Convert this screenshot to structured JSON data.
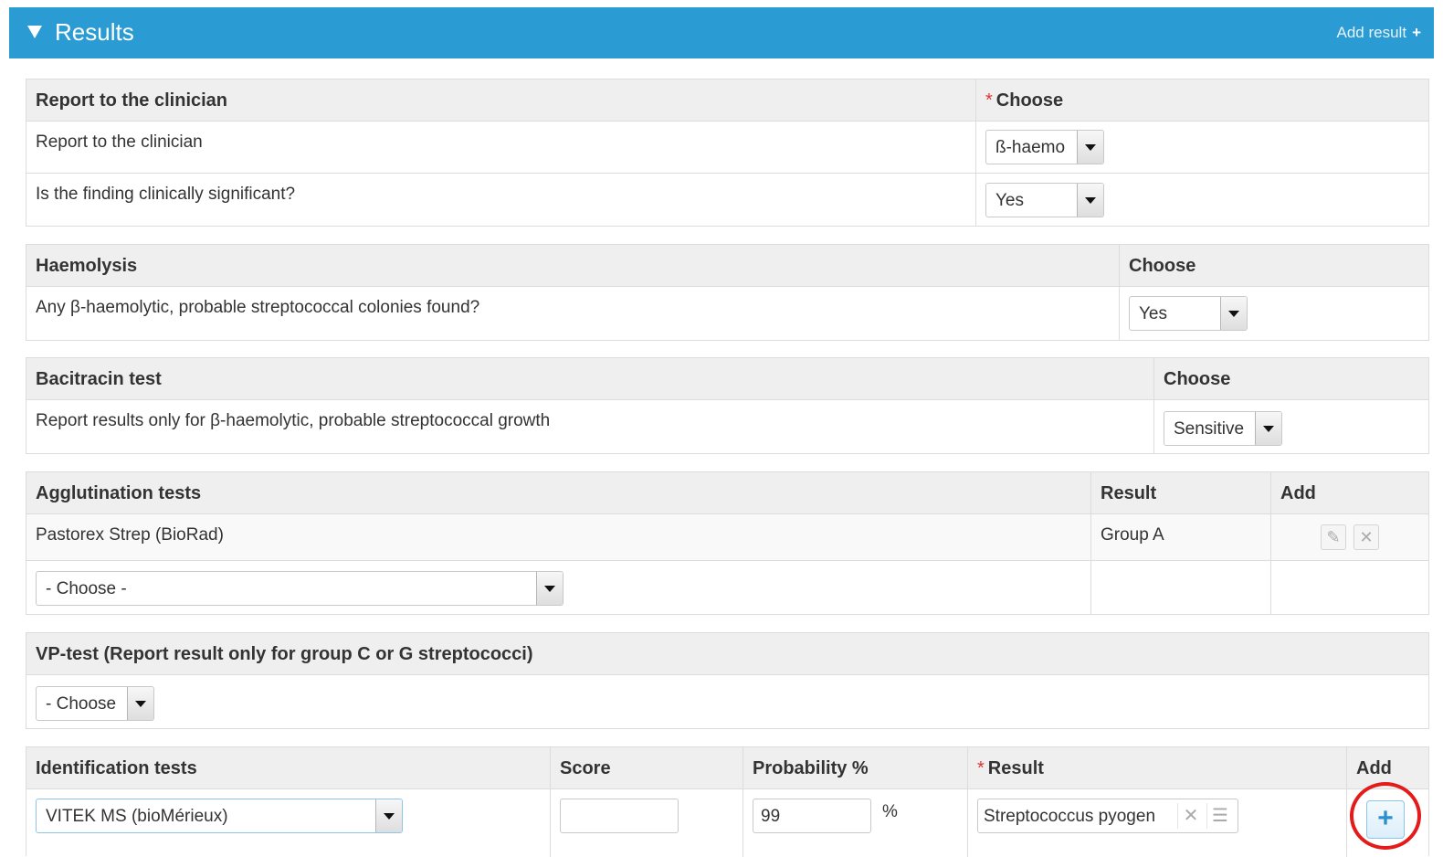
{
  "header": {
    "title": "Results",
    "add_result": "Add result",
    "add_icon": "+"
  },
  "report": {
    "heading": "Report to the clinician",
    "choose_required": "*",
    "choose_label": "Choose",
    "rows": [
      {
        "label": "Report to the clinician",
        "value": "ß-haemo"
      },
      {
        "label": "Is the finding clinically significant?",
        "value": "Yes"
      }
    ]
  },
  "haemolysis": {
    "heading": "Haemolysis",
    "choose_label": "Choose",
    "row": {
      "label": "Any β-haemolytic, probable streptococcal colonies found?",
      "value": "Yes"
    }
  },
  "bacitracin": {
    "heading": "Bacitracin test",
    "choose_label": "Choose",
    "row": {
      "label": "Report results only for β-haemolytic, probable streptococcal growth",
      "value": "Sensitive"
    }
  },
  "agglutination": {
    "heading": "Agglutination tests",
    "result_label": "Result",
    "add_label": "Add",
    "row": {
      "test": "Pastorex Strep (BioRad)",
      "result": "Group A"
    },
    "new_select": "- Choose -"
  },
  "vp_test": {
    "heading": "VP-test (Report result only for group C or G streptococci)",
    "select": "- Choose"
  },
  "identification": {
    "heading": "Identification tests",
    "score_label": "Score",
    "probability_label": "Probability %",
    "result_required": "*",
    "result_label": "Result",
    "add_label": "Add",
    "row": {
      "test": "VITEK MS (bioMérieux)",
      "score": "",
      "probability": "99",
      "percent": "%",
      "result": "Streptococcus pyogen"
    }
  },
  "icons": {
    "collapse": "triangle-down-icon",
    "edit": "pencil-icon",
    "delete": "x-icon",
    "list": "list-icon",
    "add": "plus-icon"
  }
}
